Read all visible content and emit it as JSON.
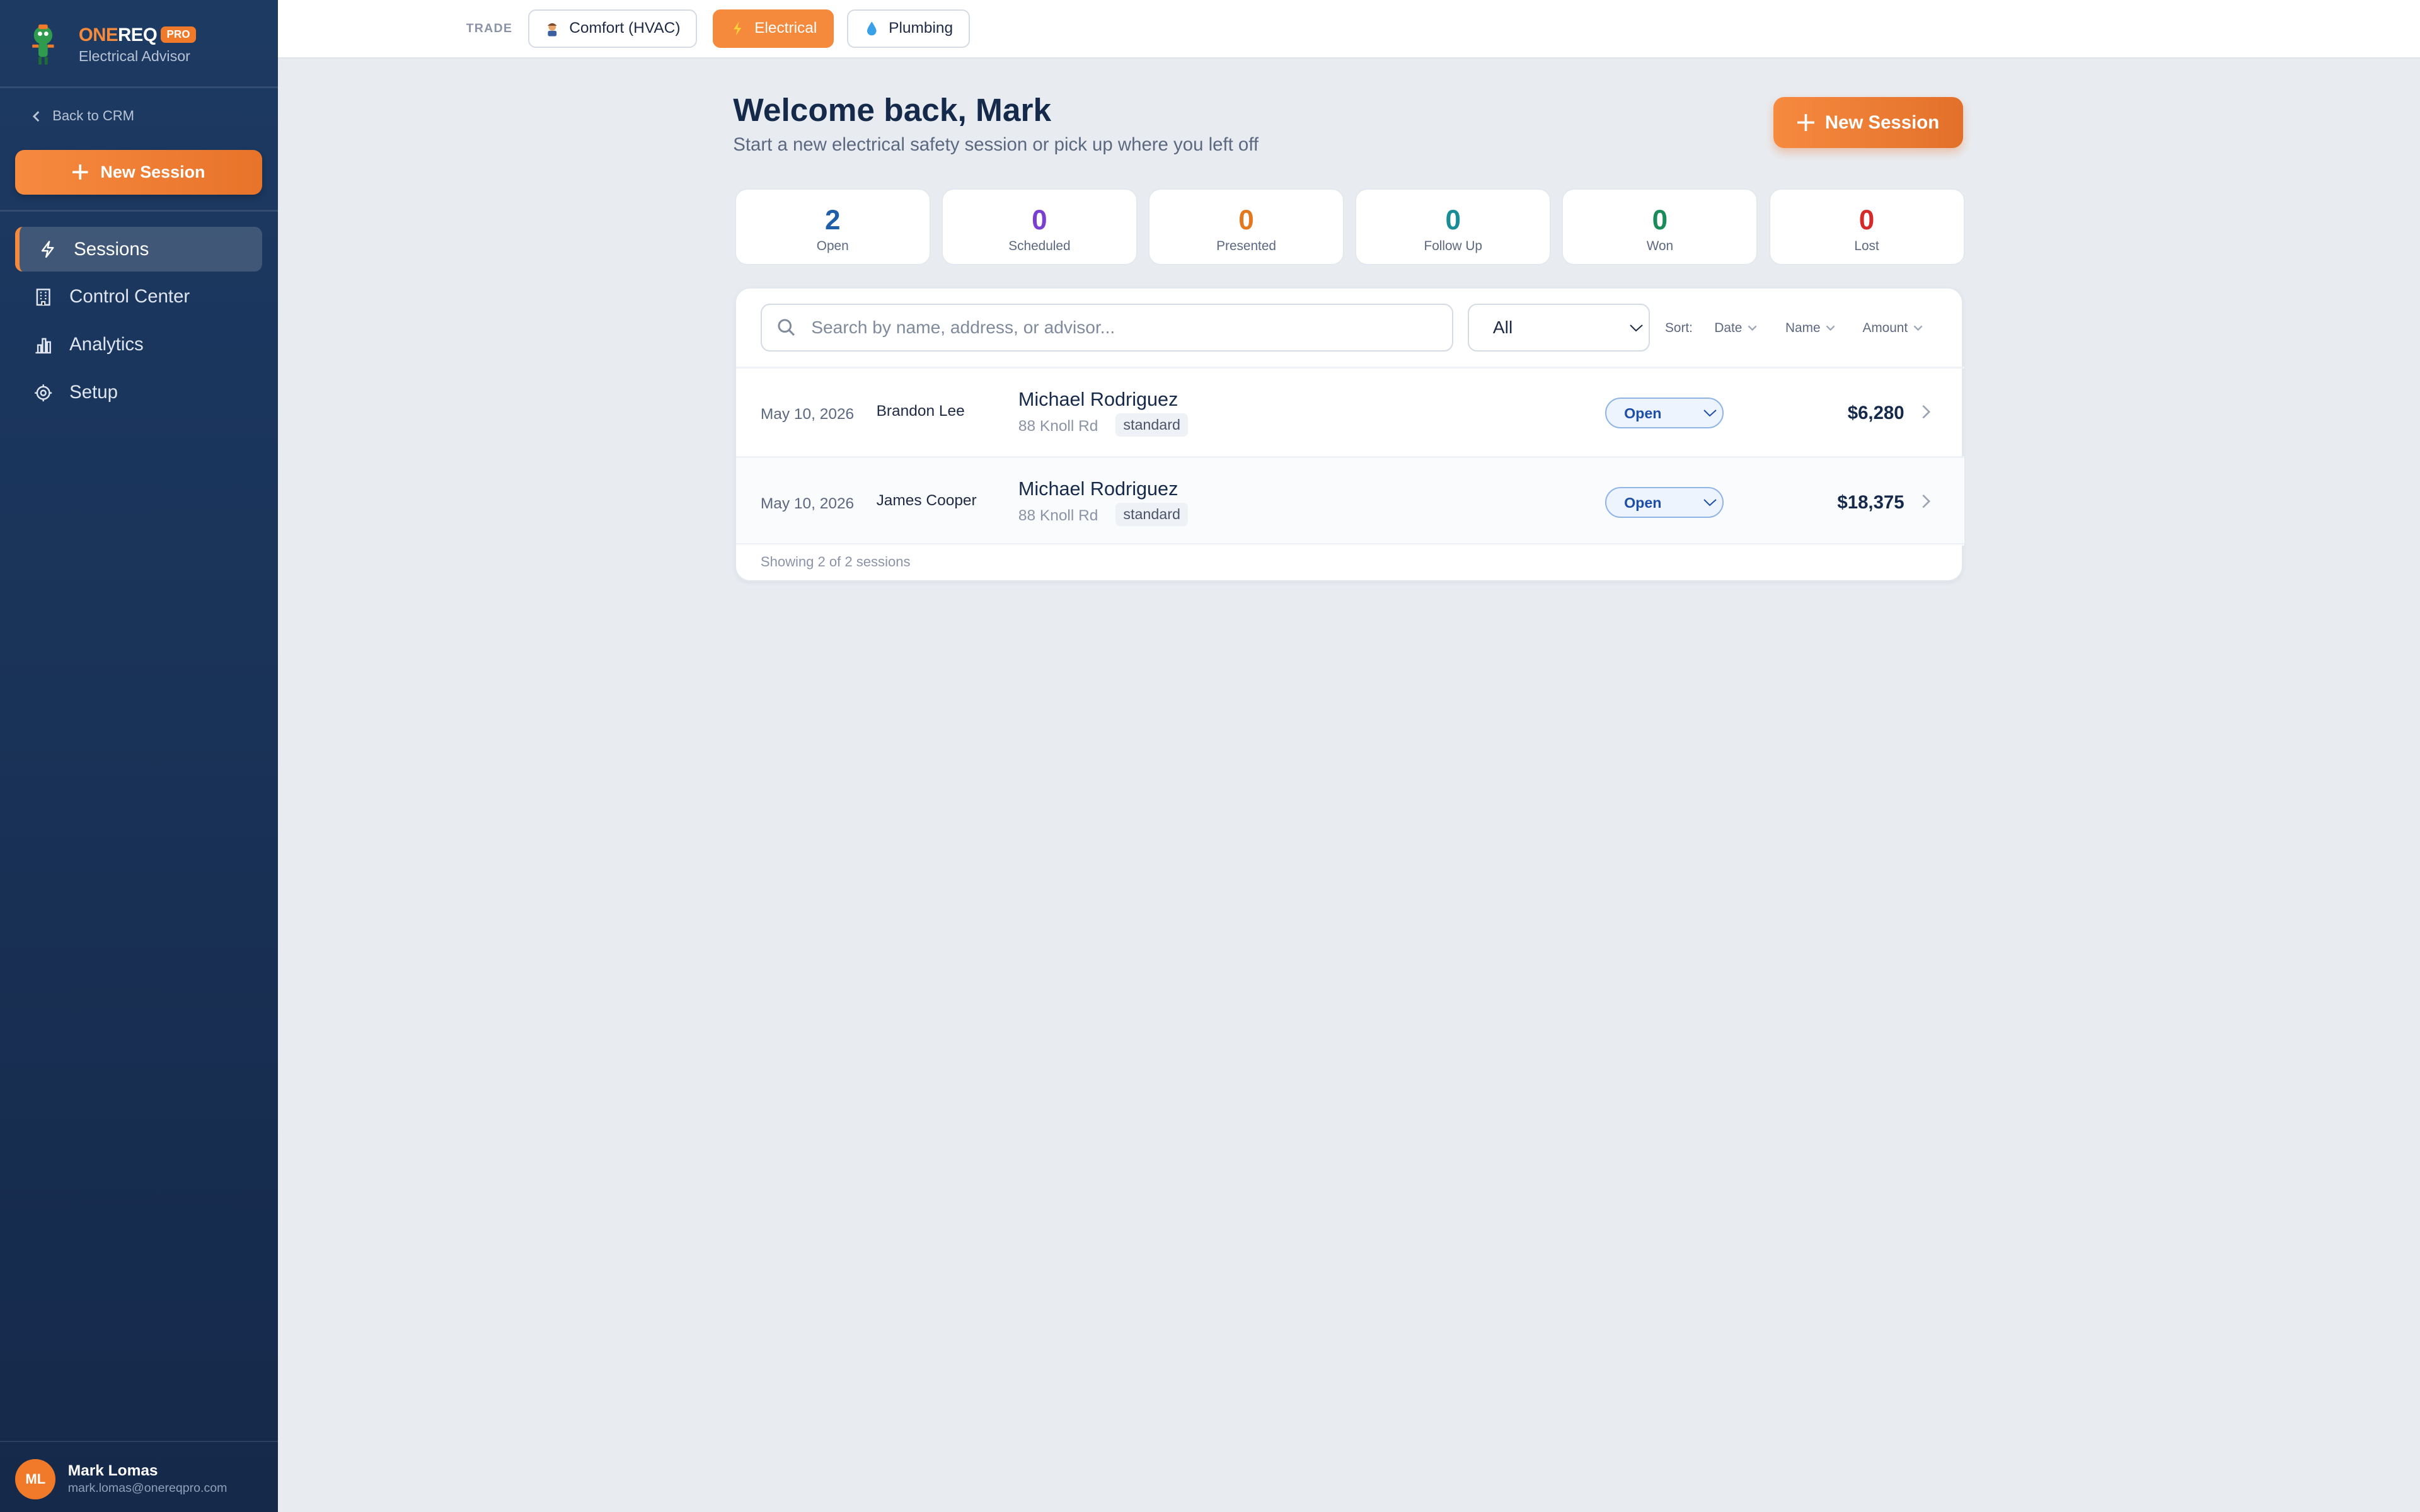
{
  "brand": {
    "one": "ONE",
    "req": "REQ",
    "badge": "PRO",
    "subtitle": "Electrical Advisor"
  },
  "sidebar": {
    "back_label": "Back to CRM",
    "new_session_label": "New Session",
    "items": [
      {
        "label": "Sessions",
        "icon": "bolt-icon",
        "active": true
      },
      {
        "label": "Control Center",
        "icon": "building-icon",
        "active": false
      },
      {
        "label": "Analytics",
        "icon": "bar-chart-icon",
        "active": false
      },
      {
        "label": "Setup",
        "icon": "gear-icon",
        "active": false
      }
    ],
    "user": {
      "initials": "ML",
      "name": "Mark Lomas",
      "email": "mark.lomas@onereqpro.com"
    }
  },
  "topbar": {
    "trade_label": "TRADE",
    "trades": [
      {
        "label": "Comfort (HVAC)",
        "icon": "technician-icon",
        "active": false
      },
      {
        "label": "Electrical",
        "icon": "bolt-icon",
        "active": true
      },
      {
        "label": "Plumbing",
        "icon": "water-drop-icon",
        "active": false
      }
    ]
  },
  "header": {
    "title": "Welcome back, Mark",
    "subtitle": "Start a new electrical safety session or pick up where you left off",
    "new_session_label": "New Session"
  },
  "stats": [
    {
      "value": "2",
      "label": "Open",
      "color": "#1f5fa8"
    },
    {
      "value": "0",
      "label": "Scheduled",
      "color": "#7a3fd1"
    },
    {
      "value": "0",
      "label": "Presented",
      "color": "#e2781f"
    },
    {
      "value": "0",
      "label": "Follow Up",
      "color": "#1a8c96"
    },
    {
      "value": "0",
      "label": "Won",
      "color": "#1a8c5a"
    },
    {
      "value": "0",
      "label": "Lost",
      "color": "#d42a2a"
    }
  ],
  "filters": {
    "search_placeholder": "Search by name, address, or advisor...",
    "status_selected": "All",
    "sort_label": "Sort:",
    "sort_options": [
      "Date",
      "Name",
      "Amount"
    ]
  },
  "sessions": [
    {
      "date": "May 10, 2026",
      "advisor": "Brandon Lee",
      "customer": "Michael Rodriguez",
      "address": "88 Knoll Rd",
      "tag": "standard",
      "status": "Open",
      "amount": "$6,280"
    },
    {
      "date": "May 10, 2026",
      "advisor": "James Cooper",
      "customer": "Michael Rodriguez",
      "address": "88 Knoll Rd",
      "tag": "standard",
      "status": "Open",
      "amount": "$18,375"
    }
  ],
  "footer": "Showing 2 of 2 sessions",
  "colors": {
    "accent": "#f58a3c",
    "sidebar": "#1d3a63",
    "background": "#e8ecf1"
  }
}
